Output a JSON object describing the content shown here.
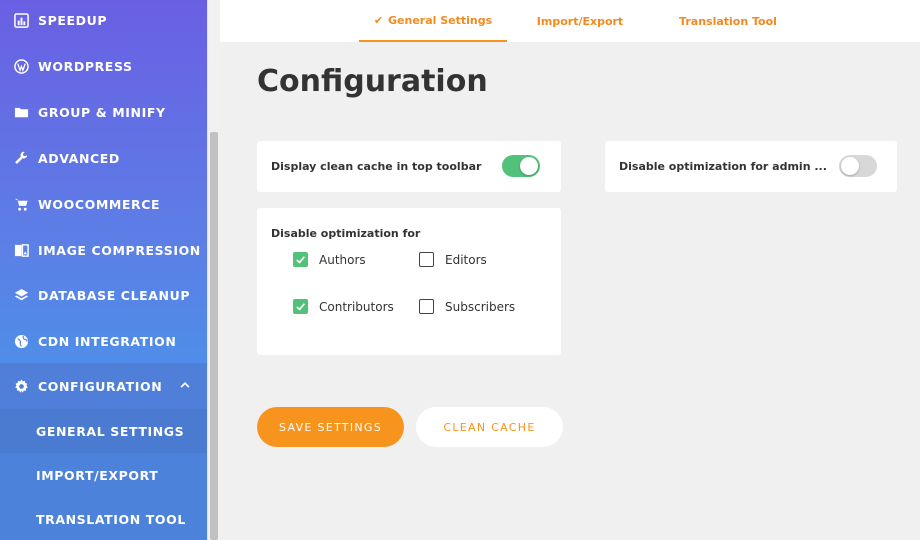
{
  "sidebar": {
    "items": [
      {
        "label": "SPEEDUP",
        "icon": "chart-icon"
      },
      {
        "label": "WORDPRESS",
        "icon": "wordpress-icon"
      },
      {
        "label": "GROUP & MINIFY",
        "icon": "folder-icon"
      },
      {
        "label": "ADVANCED",
        "icon": "wrench-icon"
      },
      {
        "label": "WOOCOMMERCE",
        "icon": "cart-icon"
      },
      {
        "label": "IMAGE COMPRESSION",
        "icon": "image-icon"
      },
      {
        "label": "DATABASE CLEANUP",
        "icon": "layers-icon"
      },
      {
        "label": "CDN INTEGRATION",
        "icon": "globe-icon"
      },
      {
        "label": "CONFIGURATION",
        "icon": "gear-icon"
      }
    ],
    "sub_items": [
      {
        "label": "GENERAL SETTINGS"
      },
      {
        "label": "IMPORT/EXPORT"
      },
      {
        "label": "TRANSLATION TOOL"
      }
    ]
  },
  "tabs": [
    {
      "label": "General Settings",
      "active": true
    },
    {
      "label": "Import/Export",
      "active": false
    },
    {
      "label": "Translation Tool",
      "active": false
    }
  ],
  "page": {
    "title": "Configuration"
  },
  "settings": {
    "clean_cache_toolbar": {
      "label": "Display clean cache in top toolbar",
      "enabled": true
    },
    "disable_admin": {
      "label": "Disable optimization for admin ...",
      "enabled": false
    },
    "disable_for": {
      "label": "Disable optimization for",
      "roles": [
        {
          "label": "Authors",
          "checked": true
        },
        {
          "label": "Editors",
          "checked": false
        },
        {
          "label": "Contributors",
          "checked": true
        },
        {
          "label": "Subscribers",
          "checked": false
        }
      ]
    }
  },
  "buttons": {
    "save": "SAVE SETTINGS",
    "clean": "CLEAN CACHE"
  },
  "colors": {
    "accent": "#f7941d",
    "toggle_on": "#52c27a",
    "sidebar_top": "#6a5fe3",
    "sidebar_bottom": "#4a90e2"
  }
}
